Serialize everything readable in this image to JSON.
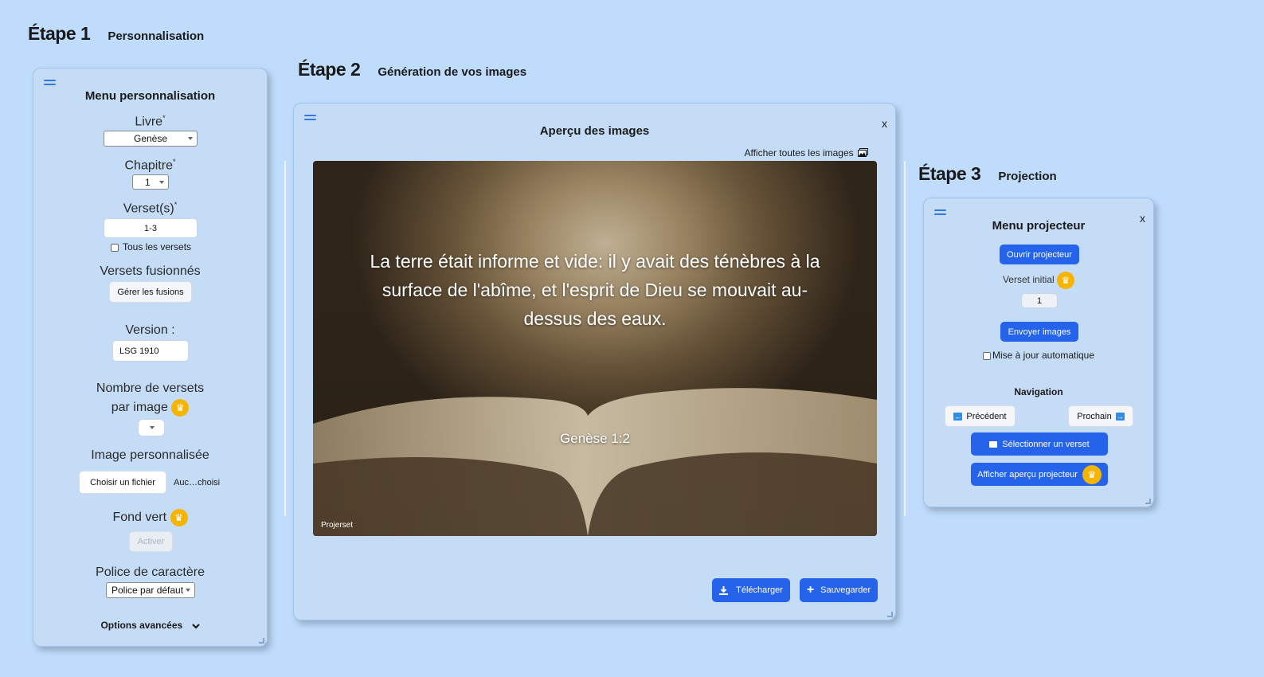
{
  "step1": {
    "number": "Étape 1",
    "title": "Personnalisation"
  },
  "step2": {
    "number": "Étape 2",
    "title": "Génération de vos images"
  },
  "step3": {
    "number": "Étape 3",
    "title": "Projection"
  },
  "menu_perso": {
    "title": "Menu personnalisation",
    "livre_label": "Livre",
    "livre_value": "Genèse",
    "chapitre_label": "Chapitre",
    "chapitre_value": "1",
    "versets_label": "Verset(s)",
    "versets_value": "1-3",
    "tous_versets": "Tous les versets",
    "fusion_label": "Versets fusionnés",
    "fusion_button": "Gérer les fusions",
    "version_label": "Version :",
    "version_value": "LSG 1910",
    "nombre_label_1": "Nombre de versets",
    "nombre_label_2": "par image",
    "image_label": "Image personnalisée",
    "file_button": "Choisir un fichier",
    "file_status": "Auc…choisi",
    "fond_label": "Fond vert",
    "fond_button": "Activer",
    "police_label": "Police de caractère",
    "police_value": "Police par défaut",
    "options": "Options avancées",
    "required_mark": "*"
  },
  "apercu": {
    "title": "Aperçu des images",
    "close": "x",
    "show_all": "Afficher toutes les images",
    "verse_text": "La terre était informe et vide: il y avait des ténèbres à la surface de l'abîme, et l'esprit de Dieu se mouvait au-dessus des eaux.",
    "reference": "Genèse 1:2",
    "watermark": "Projerset",
    "download": "Télécharger",
    "save": "Sauvegarder"
  },
  "projecteur": {
    "title": "Menu projecteur",
    "close": "x",
    "open": "Ouvrir projecteur",
    "initial_label": "Verset initial",
    "initial_value": "1",
    "send": "Envoyer images",
    "auto_update": "Mise à jour automatique",
    "nav_title": "Navigation",
    "prev": "Précédent",
    "next": "Prochain",
    "select": "Sélectionner un verset",
    "preview": "Afficher aperçu projecteur"
  },
  "colors": {
    "accent": "#2563eb",
    "crown": "#f5b400",
    "background": "#bfdcfd"
  }
}
